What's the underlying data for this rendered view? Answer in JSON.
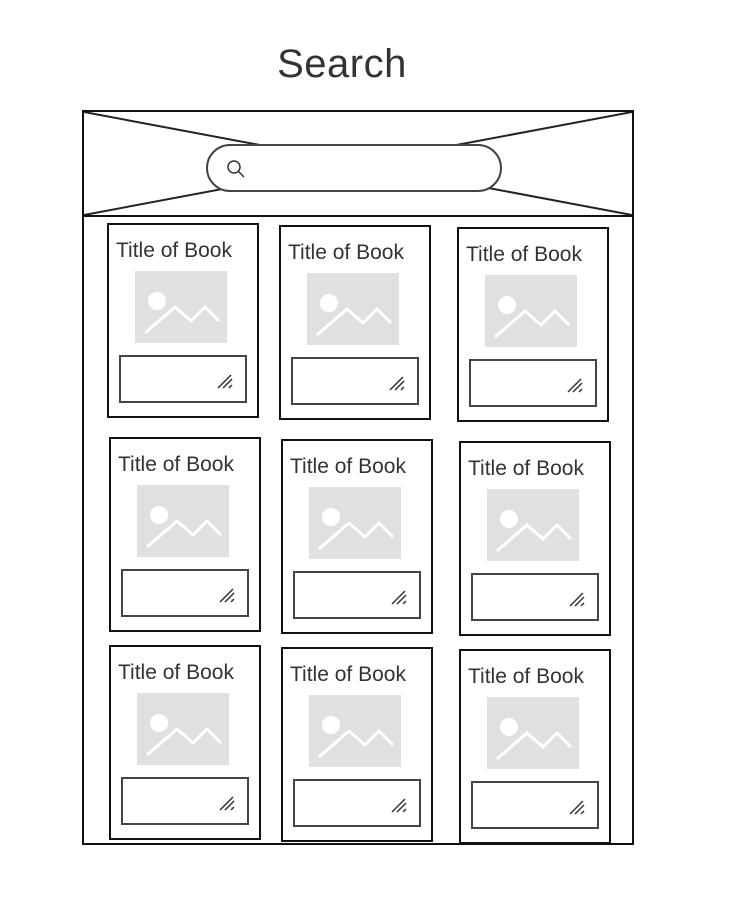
{
  "page": {
    "title": "Search"
  },
  "search": {
    "placeholder": "",
    "value": "",
    "icon": "search-icon"
  },
  "books": [
    {
      "title": "Title of Book",
      "image_icon": "image-placeholder-icon"
    },
    {
      "title": "Title of Book",
      "image_icon": "image-placeholder-icon"
    },
    {
      "title": "Title of Book",
      "image_icon": "image-placeholder-icon"
    },
    {
      "title": "Title of Book",
      "image_icon": "image-placeholder-icon"
    },
    {
      "title": "Title of Book",
      "image_icon": "image-placeholder-icon"
    },
    {
      "title": "Title of Book",
      "image_icon": "image-placeholder-icon"
    },
    {
      "title": "Title of Book",
      "image_icon": "image-placeholder-icon"
    },
    {
      "title": "Title of Book",
      "image_icon": "image-placeholder-icon"
    },
    {
      "title": "Title of Book",
      "image_icon": "image-placeholder-icon"
    }
  ],
  "colors": {
    "stroke": "#111111",
    "placeholder_fill": "#e0e0e0",
    "placeholder_shape": "#ffffff",
    "text": "#333333"
  }
}
